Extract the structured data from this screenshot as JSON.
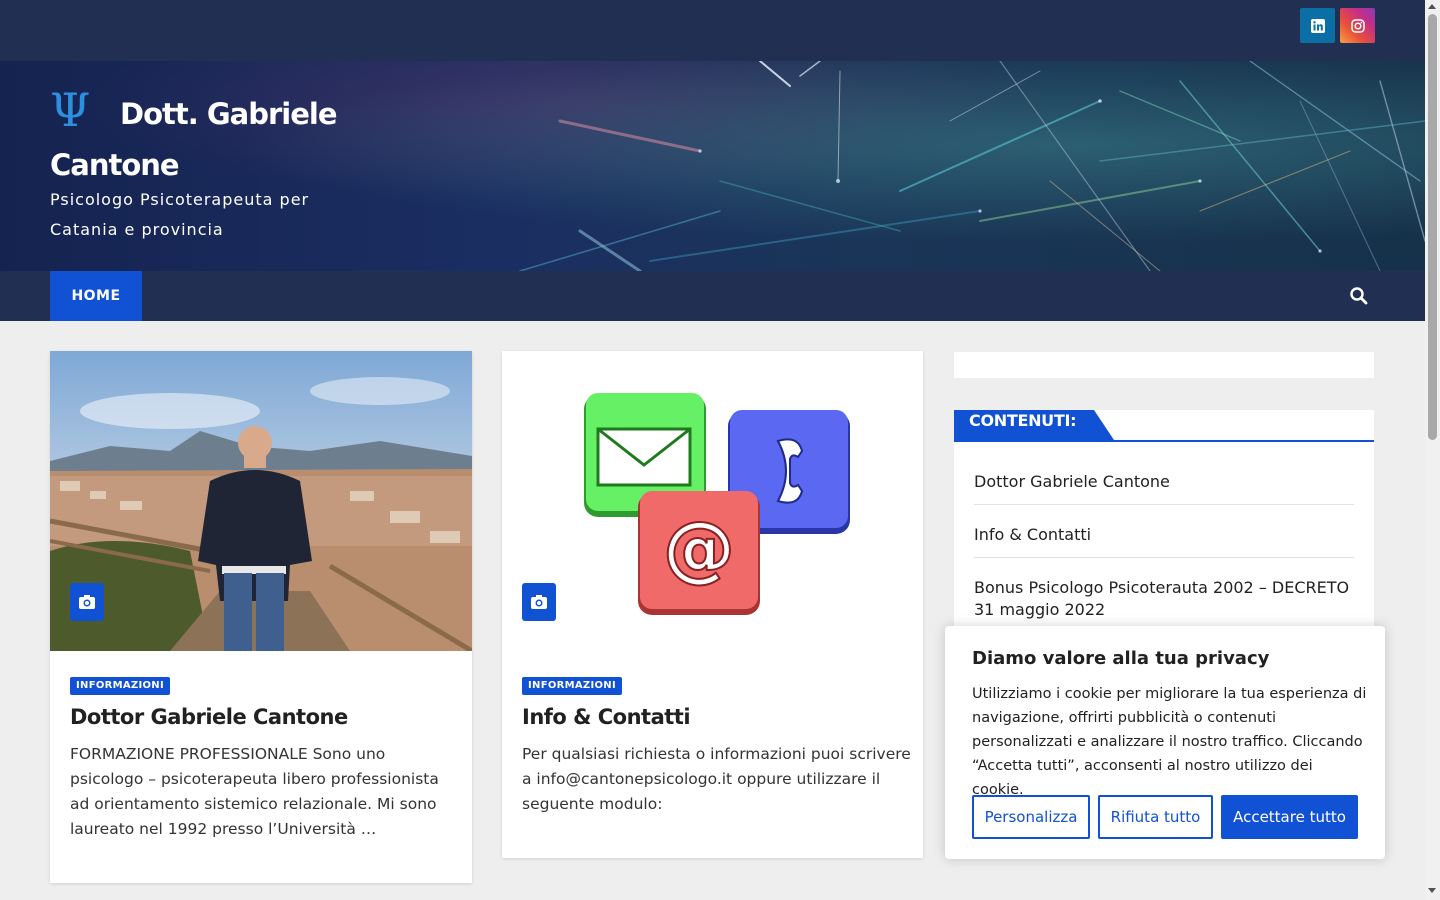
{
  "topbar": {
    "social": [
      {
        "name": "linkedin-icon",
        "label": "in"
      },
      {
        "name": "instagram-icon",
        "label": "ig"
      }
    ]
  },
  "header": {
    "logo_symbol": "Ψ",
    "site_title": "Dott. Gabriele Cantone",
    "tagline": "Psicologo Psicoterapeuta per Catania e provincia"
  },
  "nav": {
    "home_label": "HOME"
  },
  "posts": [
    {
      "category": "INFORMAZIONI",
      "title": "Dottor Gabriele Cantone",
      "excerpt": "FORMAZIONE PROFESSIONALE Sono uno psicologo – psicoterapeuta libero professionista ad orientamento sistemico relazionale. Mi sono laureato nel 1992 presso l’Università …"
    },
    {
      "category": "INFORMAZIONI",
      "title": "Info & Contatti",
      "excerpt": "Per qualsiasi richiesta o informazioni puoi scrivere a info@cantonepsicologo.it oppure utilizzare il seguente modulo:"
    }
  ],
  "sidebar": {
    "widget_title": "CONTENUTI:",
    "links": [
      "Dottor Gabriele Cantone",
      "Info & Contatti",
      "Bonus Psicologo Psicoterauta 2002 – DECRETO 31 maggio 2022"
    ]
  },
  "cookie": {
    "title": "Diamo valore alla tua privacy",
    "text": "Utilizziamo i cookie per migliorare la tua esperienza di navigazione, offrirti pubblicità o contenuti personalizzati e analizzare il nostro traffico. Cliccando “Accetta tutti”, acconsenti al nostro utilizzo dei cookie.",
    "customize_label": "Personalizza",
    "reject_label": "Rifiuta tutto",
    "accept_label": "Accettare tutto"
  },
  "colors": {
    "navy": "#212f53",
    "accent": "#1151d3"
  }
}
